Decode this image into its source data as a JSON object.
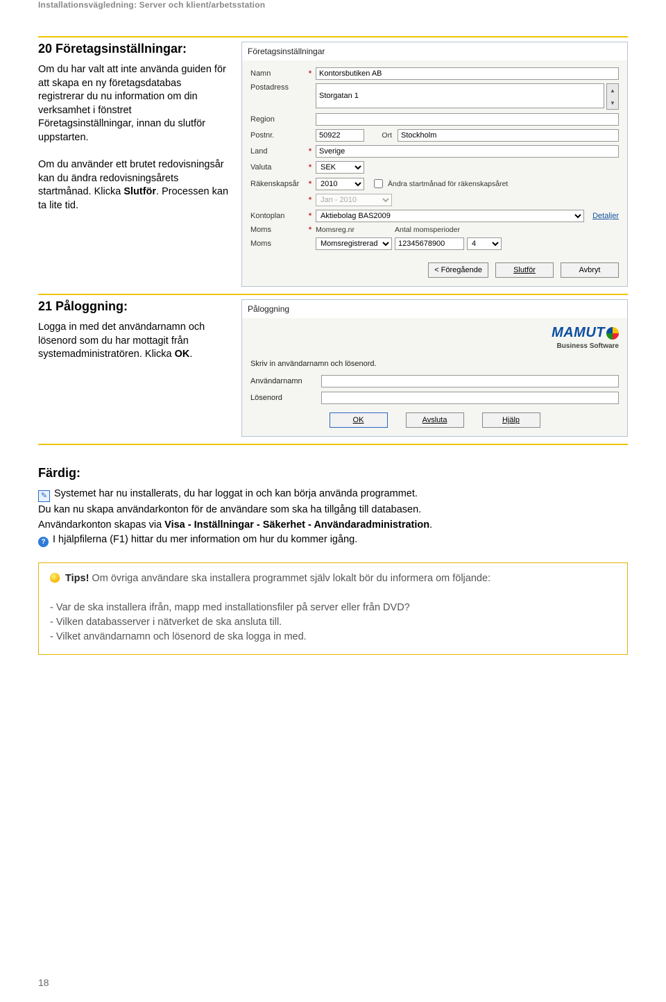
{
  "header": {
    "title": "Installationsvägledning: Server och klient/arbetsstation"
  },
  "s20": {
    "heading": "20 Företagsinställningar:",
    "body_a": "Om du har valt att inte använda guiden för att skapa en ny företagsdatabas registrerar du nu information om din verksamhet i fönstret Företagsinställningar, innan du slutför uppstarten.",
    "body_b": "Om du använder ett brutet redovisningsår kan du ändra redovisningsårets startmånad. Klicka ",
    "body_b_bold": "Slutför",
    "body_b_tail": ". Processen kan ta lite tid."
  },
  "panel1": {
    "title": "Företagsinställningar",
    "labels": {
      "namn": "Namn",
      "postadress": "Postadress",
      "region": "Region",
      "postnr": "Postnr.",
      "ort": "Ort",
      "land": "Land",
      "valuta": "Valuta",
      "rakenskapsar": "Räkenskapsår",
      "kontoplan": "Kontoplan",
      "moms1": "Moms",
      "moms2": "Moms",
      "momsregnr": "Momsreg.nr",
      "antal": "Antal momsperioder",
      "changeStart": "Ändra startmånad för räkenskapsåret"
    },
    "values": {
      "namn": "Kontorsbutiken AB",
      "postadress": "Storgatan 1",
      "region": "",
      "postnr": "50922",
      "ort": "Stockholm",
      "land": "Sverige",
      "valuta": "SEK",
      "rakenskapsar": "2010",
      "startman": "Jan - 2010",
      "kontoplan": "Aktiebolag BAS2009",
      "detaljer": "Detaljer",
      "momsreg": "Momsregistrerad",
      "momsregnr": "12345678900",
      "antal": "4"
    },
    "buttons": {
      "prev": "< Föregående",
      "finish": "Slutför",
      "cancel": "Avbryt"
    }
  },
  "s21": {
    "heading": "21 Påloggning:",
    "body_a": "Logga in med det användarnamn och lösenord som du har mottagit från systemadministratören. Klicka ",
    "body_bold": "OK",
    "body_tail": "."
  },
  "panel2": {
    "title": "Påloggning",
    "brand": "MAMUT",
    "brand_sub": "Business Software",
    "instr": "Skriv in användarnamn och lösenord.",
    "labels": {
      "user": "Användarnamn",
      "pass": "Lösenord"
    },
    "values": {
      "user": "",
      "pass": ""
    },
    "buttons": {
      "ok": "OK",
      "avsluta": "Avsluta",
      "hjalp": "Hjälp"
    }
  },
  "fardig": {
    "heading": "Färdig:",
    "l1": "Systemet har nu installerats, du har loggat in och kan börja använda programmet.",
    "l2": "Du kan nu skapa användarkonton för de användare som ska ha tillgång till databasen.",
    "l3a": "Användarkonton skapas via ",
    "l3b": "Visa - Inställningar - Säkerhet - Användaradministration",
    "l3c": ".",
    "l4": "I hjälpfilerna (F1) hittar du mer information om hur du kommer igång."
  },
  "tips": {
    "lead": "Tips!",
    "intro": " Om övriga användare ska installera programmet själv lokalt bör du informera om följande:",
    "b1": "- Var de ska installera ifrån, mapp med installationsfiler på server eller från DVD?",
    "b2": "- Vilken databasserver i nätverket de ska ansluta till.",
    "b3": "- Vilket användarnamn och lösenord de ska logga in med."
  },
  "pageNumber": "18"
}
